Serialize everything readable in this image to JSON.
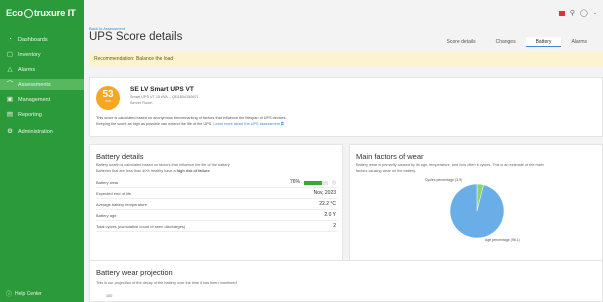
{
  "app": {
    "logo_text_left": "Eco",
    "logo_text_right": "truxure IT"
  },
  "sidebar": {
    "items": [
      {
        "label": "Dashboards",
        "icon": "dashboard-icon"
      },
      {
        "label": "Inventory",
        "icon": "inventory-icon"
      },
      {
        "label": "Alarms",
        "icon": "alarm-icon"
      },
      {
        "label": "Assessments",
        "icon": "assessment-icon"
      },
      {
        "label": "Management",
        "icon": "management-icon"
      },
      {
        "label": "Reporting",
        "icon": "reporting-icon"
      },
      {
        "label": "Administration",
        "icon": "admin-icon"
      }
    ],
    "help": "Help Center"
  },
  "header": {
    "back_link": "Back to Assessment",
    "title": "UPS Score details",
    "tabs": [
      "Score details",
      "Changes",
      "Battery",
      "Alarms"
    ],
    "active_tab": "Battery"
  },
  "banner": {
    "text": "Recommendation: Balance the load"
  },
  "summary": {
    "score": "53",
    "score_label": "/100",
    "name": "SE LV Smart UPS VT",
    "model": "Smart UPS VT 15 kVA – QD1804150671",
    "location": "Server Room",
    "desc_line1": "This score is calculated based on anonymous benchmarking of factors that influence the lifespan of UPS devices.",
    "desc_line2": "Keeping the score as high as possible can extend the life of the UPS.",
    "desc_link": "Learn more about the UPS assessment"
  },
  "battery": {
    "title": "Battery details",
    "note_line1": "Battery health is calculated based on factors that influence the life of the battery.",
    "note_line2_prefix": "Batteries that are less than 40% healthy have a ",
    "note_line2_bold": "high risk of failure.",
    "rows": [
      {
        "label": "Battery wear",
        "value": "76%"
      },
      {
        "label": "Expected end of life",
        "value": "Nov, 2023"
      },
      {
        "label": "Average battery temperature",
        "value": "22.2 °C"
      },
      {
        "label": "Battery age",
        "value": "2.0 Y"
      },
      {
        "label": "Total cycles (cumulative count of seen discharges)",
        "value": "2"
      }
    ],
    "wear_fraction": 0.76,
    "bar_color": "#3aaa35"
  },
  "wear": {
    "title": "Main factors of wear",
    "note_line1": "Battery wear is primarily caused by its age, temperature, and how often it cycles. This is an estimate of the main",
    "note_line2": "factors causing wear on the battery.",
    "chart_data": {
      "type": "pie",
      "values": [
        3.9,
        96.1
      ],
      "labels": [
        "Cycles percentage (3.9)",
        "Age percentage (96.1)"
      ],
      "colors": [
        "#8bd46a",
        "#6aaee8"
      ]
    }
  },
  "projection": {
    "title": "Battery wear projection",
    "note": "This is our projection of the decay of the battery over the time it has been monitored",
    "y_tick": "100"
  }
}
